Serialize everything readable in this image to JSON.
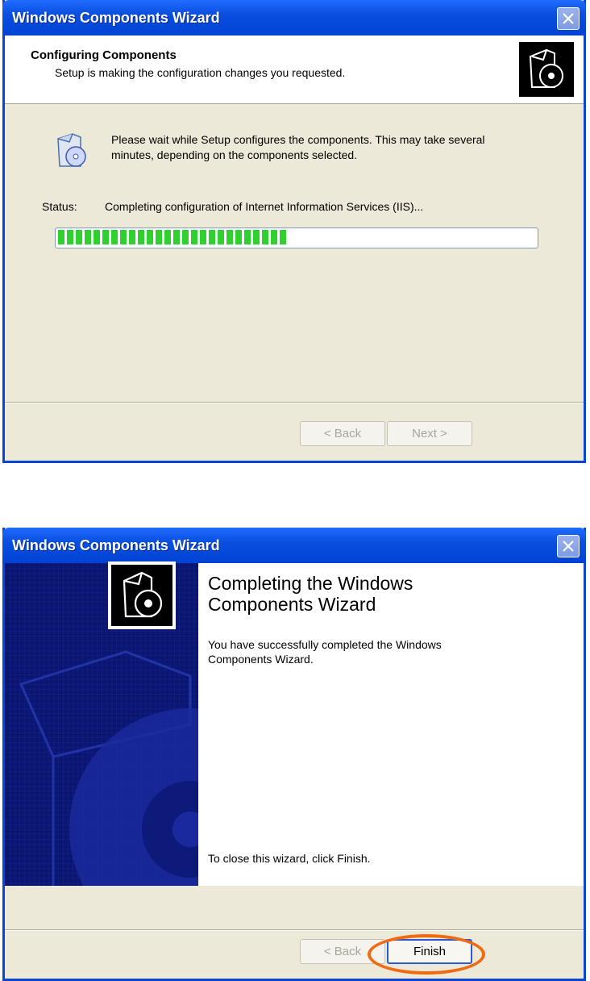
{
  "window1": {
    "title": "Windows Components Wizard",
    "header_title": "Configuring Components",
    "header_subtitle": "Setup is making the configuration changes you requested.",
    "message": "Please wait while Setup configures the components. This may take several minutes, depending on the components selected.",
    "status_label": "Status:",
    "status_text": "Completing configuration of Internet Information Services (IIS)...",
    "progress_percent": 48,
    "back_label": "< Back",
    "next_label": "Next >"
  },
  "window2": {
    "title": "Windows Components Wizard",
    "heading": "Completing the Windows Components Wizard",
    "success_text": "You have successfully completed the Windows Components Wizard.",
    "close_text": "To close this wizard, click Finish.",
    "back_label": "< Back",
    "finish_label": "Finish"
  },
  "colors": {
    "title_bar": "#0a4fe0",
    "progress_fill": "#2ed12e",
    "highlight_circle": "#ef6a11",
    "side_panel": "#0b1670"
  },
  "icons": [
    "close-icon",
    "setup-box-cd-icon",
    "setup-box-cd-small-icon"
  ]
}
